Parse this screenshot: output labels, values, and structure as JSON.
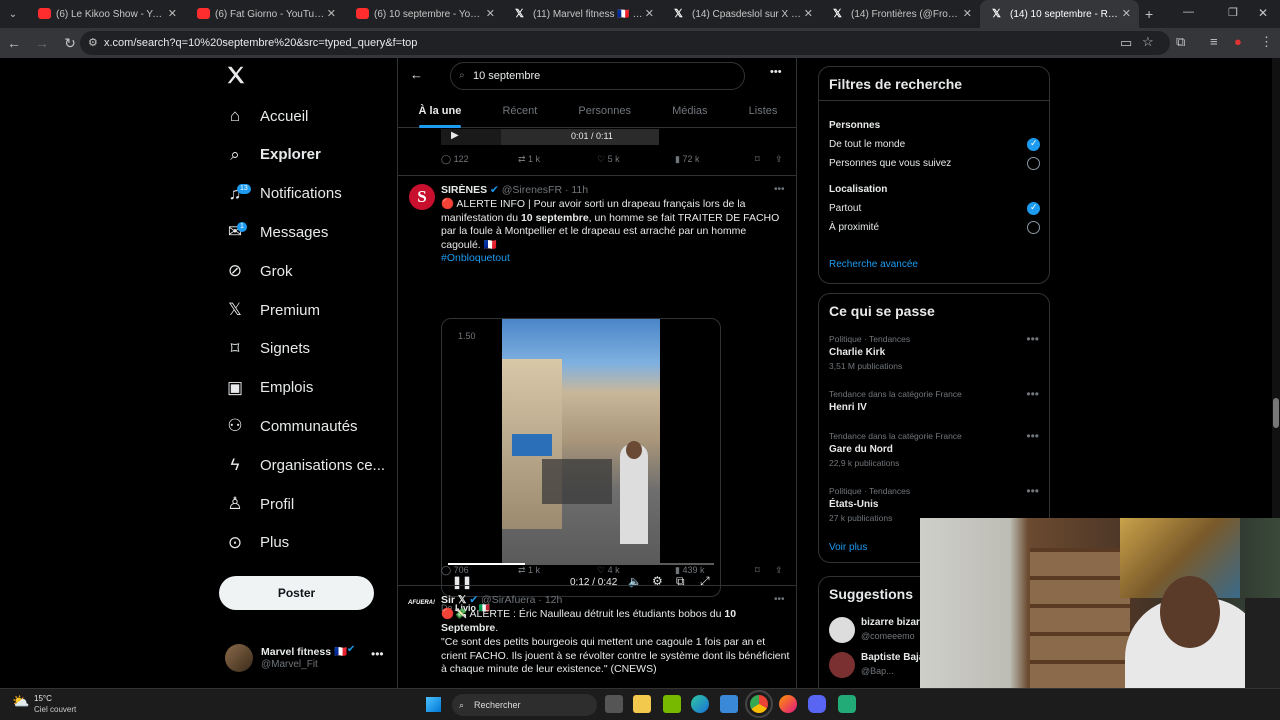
{
  "browser": {
    "tabs": [
      {
        "title": "(6) Le Kikoo Show - YouTube",
        "kind": "yt"
      },
      {
        "title": "(6) Fat Giorno - YouTube",
        "kind": "yt"
      },
      {
        "title": "(6) 10 septembre - YouTube",
        "kind": "yt"
      },
      {
        "title": "(11) Marvel fitness 🇫🇷 sur X : \"",
        "kind": "x"
      },
      {
        "title": "(14) Cpasdeslol sur X : \"🇫🇷 Al",
        "kind": "x"
      },
      {
        "title": "(14) Frontières (@Frontieresme",
        "kind": "x"
      },
      {
        "title": "(14) 10 septembre - Recher",
        "kind": "x"
      }
    ],
    "url": "x.com/search?q=10%20septembre%20&src=typed_query&f=top"
  },
  "sidebar": {
    "items": [
      {
        "label": "Accueil",
        "icon": "home-icon"
      },
      {
        "label": "Explorer",
        "icon": "search-icon"
      },
      {
        "label": "Notifications",
        "icon": "bell-icon",
        "badge": "13"
      },
      {
        "label": "Messages",
        "icon": "mail-icon",
        "badge": "1"
      },
      {
        "label": "Grok",
        "icon": "grok-icon"
      },
      {
        "label": "Premium",
        "icon": "x-logo-icon"
      },
      {
        "label": "Signets",
        "icon": "bookmark-icon"
      },
      {
        "label": "Emplois",
        "icon": "briefcase-icon"
      },
      {
        "label": "Communautés",
        "icon": "communities-icon"
      },
      {
        "label": "Organisations ce...",
        "icon": "lightning-icon"
      },
      {
        "label": "Profil",
        "icon": "person-icon"
      },
      {
        "label": "Plus",
        "icon": "more-circle-icon"
      }
    ],
    "post_label": "Poster",
    "account": {
      "name": "Marvel fitness 🇫🇷",
      "handle": "@Marvel_Fit"
    }
  },
  "main": {
    "search_value": "10 septembre",
    "tabs": [
      "À la une",
      "Récent",
      "Personnes",
      "Médias",
      "Listes"
    ],
    "active_tab": "À la une",
    "prev_tweet": {
      "video_time": "0:01 / 0:11",
      "replies": "122",
      "reposts": "1 k",
      "likes": "5 k",
      "views": "72 k"
    },
    "tweet1": {
      "name": "SIRÈNES",
      "handle": "@SirenesFR",
      "time": "11h",
      "text_a": "🔴 ALERTE INFO | Pour avoir sorti un drapeau français lors de la manifestation du ",
      "text_bold": "10 septembre",
      "text_b": ", un homme se fait TRAITER DE FACHO par la foule à Montpellier et le drapeau est arraché par un homme cagoulé. 🇫🇷",
      "hashtag": "#Onbloquetout",
      "video_speed": "1.50",
      "video_time": "0:12 / 0:42",
      "video_progress": 0.29,
      "credit_prefix": "De",
      "credit_name": "Livio 🇮🇹",
      "replies": "706",
      "reposts": "1 k",
      "likes": "4 k",
      "views": "439 k"
    },
    "tweet2": {
      "name": "Sir 𝕏",
      "handle": "@SirAfuera",
      "time": "12h",
      "avatar_text": "AFUERA!",
      "line1_a": "🔴💸 ALERTE : Éric Naulleau détruit les étudiants bobos du ",
      "line1_bold": "10 Septembre",
      "line1_b": ".",
      "quote": "\"Ce sont des petits bourgeois qui mettent une cagoule 1 fois par an et crient FACHO. Ils jouent à se révolter contre le système dont ils bénéficient à chaque minute de leur existence.\" (CNEWS)"
    }
  },
  "filters": {
    "title": "Filtres de recherche",
    "people_heading": "Personnes",
    "people_opts": [
      {
        "label": "De tout le monde",
        "on": true
      },
      {
        "label": "Personnes que vous suivez",
        "on": false
      }
    ],
    "location_heading": "Localisation",
    "location_opts": [
      {
        "label": "Partout",
        "on": true
      },
      {
        "label": "À proximité",
        "on": false
      }
    ],
    "advanced": "Recherche avancée"
  },
  "trends": {
    "title": "Ce qui se passe",
    "items": [
      {
        "category": "Politique · Tendances",
        "name": "Charlie Kirk",
        "count": "3,51 M publications"
      },
      {
        "category": "Tendance dans la catégorie France",
        "name": "Henri IV",
        "count": ""
      },
      {
        "category": "Tendance dans la catégorie France",
        "name": "Gare du Nord",
        "count": "22,9 k publications"
      },
      {
        "category": "Politique · Tendances",
        "name": "États-Unis",
        "count": "27 k publications"
      }
    ],
    "show_more": "Voir plus"
  },
  "suggestions": {
    "title": "Suggestions",
    "items": [
      {
        "name": "bizarre bizar",
        "handle": "@comeeemo"
      },
      {
        "name": "Baptiste Baja",
        "handle": "@Bap..."
      }
    ]
  },
  "taskbar": {
    "temp": "15°C",
    "weather": "Ciel couvert",
    "search_placeholder": "Rechercher"
  },
  "colors": {
    "accent": "#1d9bf0",
    "bg": "#000000",
    "border": "#2f3336",
    "muted": "#71767b"
  }
}
